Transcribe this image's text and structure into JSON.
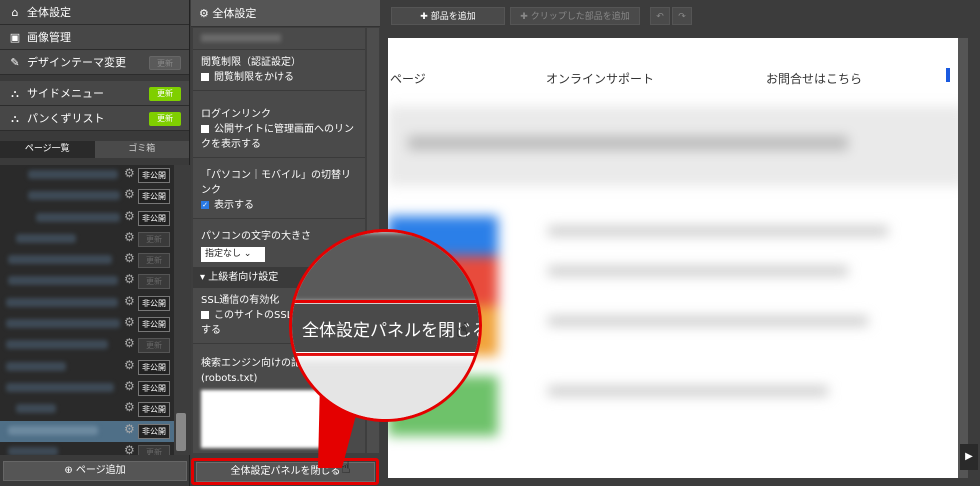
{
  "sidebar": {
    "items": [
      {
        "label": "全体設定",
        "icon": "home-icon",
        "badge": ""
      },
      {
        "label": "画像管理",
        "icon": "image-icon",
        "badge": ""
      },
      {
        "label": "デザインテーマ変更",
        "icon": "brush-icon",
        "badge": "更新",
        "badge_state": "off"
      },
      {
        "label": "サイドメニュー",
        "icon": "sitemap-icon",
        "badge": "更新",
        "badge_state": "on"
      },
      {
        "label": "パンくずリスト",
        "icon": "sitemap-icon",
        "badge": "更新",
        "badge_state": "on"
      }
    ],
    "tabs": [
      "ページ一覧",
      "ゴミ箱"
    ],
    "page_rows": [
      {
        "status": "非公開",
        "published": true
      },
      {
        "status": "非公開",
        "published": true
      },
      {
        "status": "非公開",
        "published": true
      },
      {
        "status": "更新",
        "published": false
      },
      {
        "status": "更新",
        "published": false
      },
      {
        "status": "更新",
        "published": false
      },
      {
        "status": "非公開",
        "published": true
      },
      {
        "status": "非公開",
        "published": true
      },
      {
        "status": "更新",
        "published": false
      },
      {
        "status": "非公開",
        "published": true
      },
      {
        "status": "非公開",
        "published": true
      },
      {
        "status": "非公開",
        "published": true
      },
      {
        "status": "非公開",
        "published": true
      },
      {
        "status": "更新",
        "published": false
      }
    ],
    "add_page": "ページ追加"
  },
  "panel": {
    "title": "全体設定",
    "access_title": "閲覧制限（認証設定）",
    "access_checkbox": "閲覧制限をかける",
    "login_title": "ログインリンク",
    "login_checkbox": "公開サイトに管理画面へのリンクを表示する",
    "switch_title": "「パソコン｜モバイル」の切替リンク",
    "switch_checkbox": "表示する",
    "font_title": "パソコンの文字の大きさ",
    "font_select": "指定なし",
    "advanced": "上級者向け設定",
    "ssl_title": "SSL通信の有効化",
    "ssl_checkbox": "このサイトのSSL通信を有効にする",
    "seo_title": "検索エンジン向けの記述",
    "seo_sub": "(robots.txt)",
    "close_button": "全体設定パネルを閉じる"
  },
  "toolbar": {
    "add_part": "部品を追加",
    "add_clipped": "クリップした部品を追加"
  },
  "preview": {
    "nav": [
      "ページ",
      "オンラインサポート",
      "お問合せはこちら"
    ]
  },
  "zoom": {
    "label": "全体設定パネルを閉じる"
  },
  "colors": {
    "highlight": "#e40000",
    "badge_on": "#7fcf00",
    "selected_row": "#4f6f87"
  }
}
